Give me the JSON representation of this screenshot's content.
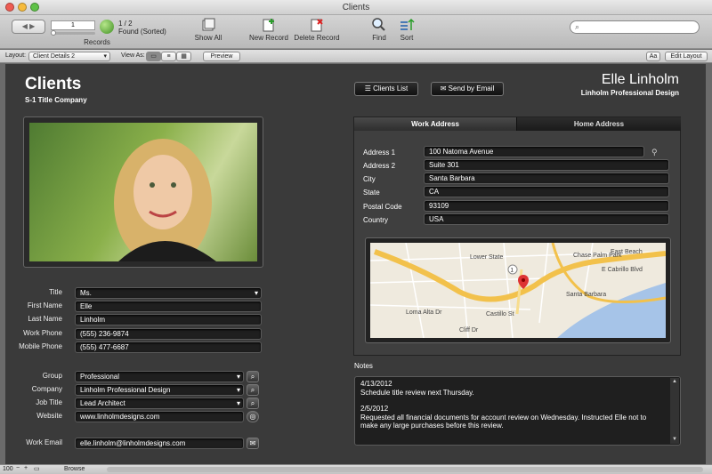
{
  "window": {
    "title": "Clients"
  },
  "toolbar": {
    "record_input": "1",
    "record_count": "1 / 2",
    "found_status": "Found (Sorted)",
    "records_label": "Records",
    "show_all": "Show All",
    "new_record": "New Record",
    "delete_record": "Delete Record",
    "find": "Find",
    "sort": "Sort",
    "search_placeholder": ""
  },
  "layoutbar": {
    "layout_label": "Layout:",
    "layout_value": "Client Details 2",
    "view_as": "View As:",
    "preview": "Preview",
    "text_size": "Aa",
    "edit_layout": "Edit Layout"
  },
  "header": {
    "title": "Clients",
    "subtitle": "S-1 Title Company",
    "clients_list": "Clients List",
    "send_email": "Send by Email",
    "client_name": "Elle Linholm",
    "client_company": "Linholm Professional Design"
  },
  "contact": {
    "fields": [
      {
        "label": "Title",
        "value": "Ms."
      },
      {
        "label": "First Name",
        "value": "Elle"
      },
      {
        "label": "Last Name",
        "value": "Linholm"
      },
      {
        "label": "Work Phone",
        "value": "(555) 236-9874"
      },
      {
        "label": "Mobile Phone",
        "value": "(555) 477-6687"
      }
    ]
  },
  "work": {
    "fields": [
      {
        "label": "Group",
        "value": "Professional"
      },
      {
        "label": "Company",
        "value": "Linholm Professional Design"
      },
      {
        "label": "Job Title",
        "value": "Lead Architect"
      },
      {
        "label": "Website",
        "value": "www.linholmdesigns.com"
      }
    ],
    "email_label": "Work Email",
    "email_value": "elle.linholm@linholmdesigns.com"
  },
  "address": {
    "tabs": [
      "Work Address",
      "Home Address"
    ],
    "fields": [
      {
        "label": "Address 1",
        "value": "100 Natoma Avenue"
      },
      {
        "label": "Address 2",
        "value": "Suite 301"
      },
      {
        "label": "City",
        "value": "Santa Barbara"
      },
      {
        "label": "State",
        "value": "CA"
      },
      {
        "label": "Postal Code",
        "value": "93109"
      },
      {
        "label": "Country",
        "value": "USA"
      }
    ]
  },
  "map": {
    "labels": [
      "Lower State",
      "Chase Palm Park",
      "East Beach",
      "E Cabrillo Blvd",
      "Loma Alta Dr",
      "Castillo St",
      "Cliff Dr",
      "Santa Barbara"
    ],
    "route": "1"
  },
  "notes": {
    "label": "Notes",
    "lines": [
      "4/13/2012",
      "Schedule title review next Thursday.",
      "",
      "2/5/2012",
      "Requested all financial documents for account review on Wednesday. Instructed Elle not to",
      "make any large purchases before this review."
    ]
  },
  "status": {
    "zoom": "100",
    "mode": "Browse"
  },
  "colors": {
    "panel": "#3a3a3a",
    "field": "#1f1f1f",
    "map_water": "#a6c4e8",
    "map_land": "#efeade",
    "map_highway": "#f2c14b"
  }
}
